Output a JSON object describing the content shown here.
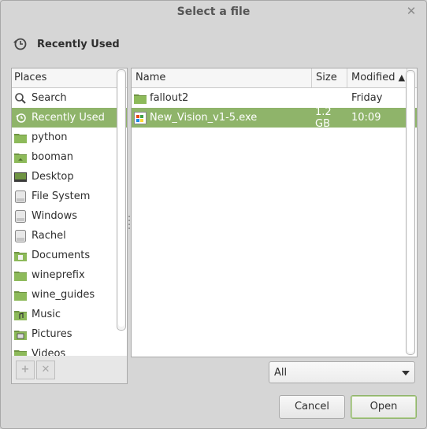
{
  "window": {
    "title": "Select a file",
    "close_glyph": "✕"
  },
  "location": {
    "label": "Recently Used",
    "icon": "recent-clock-icon"
  },
  "places": {
    "header": "Places",
    "items": [
      {
        "label": "Search",
        "icon": "search-icon"
      },
      {
        "label": "Recently Used",
        "icon": "recent-clock-icon",
        "selected": true
      },
      {
        "label": "python",
        "icon": "folder-icon"
      },
      {
        "label": "booman",
        "icon": "home-folder-icon"
      },
      {
        "label": "Desktop",
        "icon": "desktop-icon"
      },
      {
        "label": "File System",
        "icon": "drive-icon"
      },
      {
        "label": "Windows",
        "icon": "drive-icon"
      },
      {
        "label": "Rachel",
        "icon": "drive-icon"
      },
      {
        "label": "Documents",
        "icon": "documents-folder-icon"
      },
      {
        "label": "wineprefix",
        "icon": "folder-icon"
      },
      {
        "label": "wine_guides",
        "icon": "folder-icon"
      },
      {
        "label": "Music",
        "icon": "music-folder-icon"
      },
      {
        "label": "Pictures",
        "icon": "pictures-folder-icon"
      },
      {
        "label": "Videos",
        "icon": "videos-folder-icon"
      }
    ],
    "add_glyph": "+",
    "remove_glyph": "✕"
  },
  "files": {
    "columns": {
      "name": "Name",
      "size": "Size",
      "modified": "Modified",
      "sort_glyph": "▲"
    },
    "rows": [
      {
        "name": "fallout2",
        "size": "",
        "modified": "Friday",
        "icon": "folder-icon"
      },
      {
        "name": "New_Vision_v1-5.exe",
        "size": "1.2 GB",
        "modified": "10:09",
        "icon": "exe-icon",
        "selected": true
      }
    ]
  },
  "filter": {
    "value": "All"
  },
  "buttons": {
    "cancel": "Cancel",
    "open": "Open"
  },
  "colors": {
    "selection": "#8fb46a",
    "folder_green": "#7da04f"
  }
}
